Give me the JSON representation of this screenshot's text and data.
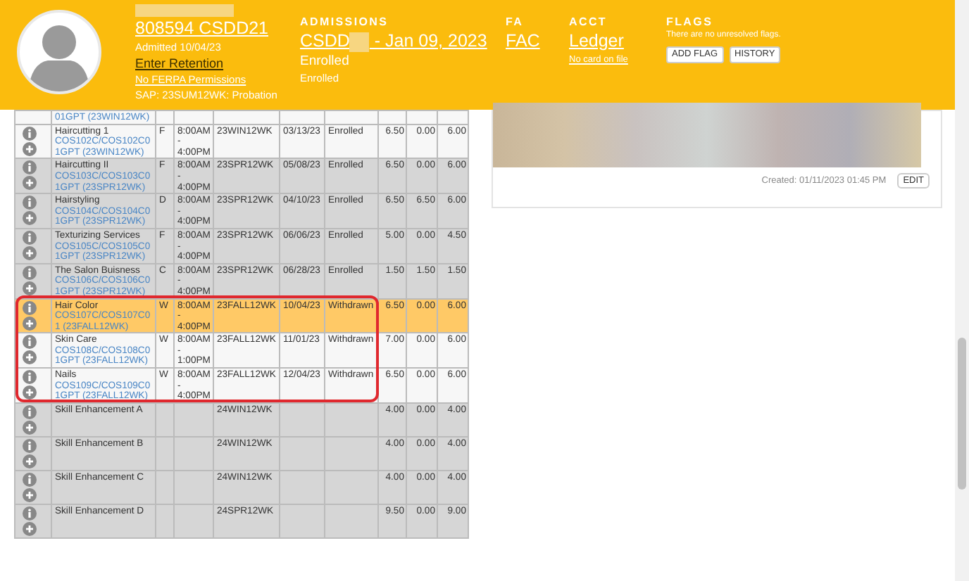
{
  "header": {
    "student": {
      "id_link": "808594 CSDD21",
      "admitted": "Admitted 10/04/23",
      "retention_link": "Enter Retention",
      "ferpa_link": "No FERPA Permissions",
      "sap": "SAP: 23SUM12WK: Probation"
    },
    "admissions": {
      "label": "ADMISSIONS",
      "link_start": "CSDD",
      "link_end": "- Jan 09, 2023",
      "status": "Enrolled",
      "substatus": "Enrolled"
    },
    "fa": {
      "label": "FA",
      "link": "FAC"
    },
    "acct": {
      "label": "ACCT",
      "link": "Ledger",
      "card_link": "No card on file"
    },
    "flags": {
      "label": "FLAGS",
      "message": "There are no unresolved flags.",
      "buttons": [
        "ADD FLAG",
        "HISTORY"
      ]
    }
  },
  "courses": [
    {
      "kind": "partial",
      "shaded": false,
      "selected": false,
      "circled": false,
      "code": "01GPT (23WIN12WK)"
    },
    {
      "kind": "course",
      "shaded": false,
      "selected": false,
      "circled": false,
      "name": "Haircutting 1",
      "code": "COS102C/COS102C01GPT (23WIN12WK)",
      "grade": "F",
      "time": "8:00AM - 4:00PM",
      "term": "23WIN12WK",
      "date": "03/13/23",
      "status": "Enrolled",
      "value_1": "6.50",
      "value_2": "0.00",
      "value_3": "6.00"
    },
    {
      "kind": "course",
      "shaded": true,
      "selected": false,
      "circled": false,
      "name": "Haircutting II",
      "code": "COS103C/COS103C01GPT (23SPR12WK)",
      "grade": "F",
      "time": "8:00AM - 4:00PM",
      "term": "23SPR12WK",
      "date": "05/08/23",
      "status": "Enrolled",
      "value_1": "6.50",
      "value_2": "0.00",
      "value_3": "6.00"
    },
    {
      "kind": "course",
      "shaded": true,
      "selected": false,
      "circled": false,
      "name": "Hairstyling",
      "code": "COS104C/COS104C01GPT (23SPR12WK)",
      "grade": "D",
      "time": "8:00AM - 4:00PM",
      "term": "23SPR12WK",
      "date": "04/10/23",
      "status": "Enrolled",
      "value_1": "6.50",
      "value_2": "6.50",
      "value_3": "6.00"
    },
    {
      "kind": "course",
      "shaded": true,
      "selected": false,
      "circled": false,
      "name": "Texturizing Services",
      "code": "COS105C/COS105C01GPT (23SPR12WK)",
      "grade": "F",
      "time": "8:00AM - 4:00PM",
      "term": "23SPR12WK",
      "date": "06/06/23",
      "status": "Enrolled",
      "value_1": "5.00",
      "value_2": "0.00",
      "value_3": "4.50"
    },
    {
      "kind": "course",
      "shaded": true,
      "selected": false,
      "circled": false,
      "name": "The Salon Buisness",
      "code": "COS106C/COS106C01GPT (23SPR12WK)",
      "grade": "C",
      "time": "8:00AM - 4:00PM",
      "term": "23SPR12WK",
      "date": "06/28/23",
      "status": "Enrolled",
      "value_1": "1.50",
      "value_2": "1.50",
      "value_3": "1.50"
    },
    {
      "kind": "course",
      "selected": true,
      "circled": true,
      "name": "Hair Color",
      "code": "COS107C/COS107C01 (23FALL12WK)",
      "grade": "W",
      "time": "8:00AM - 4:00PM",
      "term": "23FALL12WK",
      "date": "10/04/23",
      "status": "Withdrawn",
      "value_1": "6.50",
      "value_2": "0.00",
      "value_3": "6.00"
    },
    {
      "kind": "course",
      "shaded": false,
      "selected": false,
      "circled": true,
      "name": "Skin Care",
      "code": "COS108C/COS108C01GPT (23FALL12WK)",
      "grade": "W",
      "time": "8:00AM - 1:00PM",
      "term": "23FALL12WK",
      "date": "11/01/23",
      "status": "Withdrawn",
      "value_1": "7.00",
      "value_2": "0.00",
      "value_3": "6.00"
    },
    {
      "kind": "course",
      "shaded": false,
      "selected": false,
      "circled": true,
      "name": "Nails",
      "code": "COS109C/COS109C01GPT (23FALL12WK)",
      "grade": "W",
      "time": "8:00AM - 4:00PM",
      "term": "23FALL12WK",
      "date": "12/04/23",
      "status": "Withdrawn",
      "value_1": "6.50",
      "value_2": "0.00",
      "value_3": "6.00"
    },
    {
      "kind": "course",
      "shaded": true,
      "selected": false,
      "circled": false,
      "name": "Skill Enhancement A",
      "term": "24WIN12WK",
      "value_1": "4.00",
      "value_2": "0.00",
      "value_3": "4.00"
    },
    {
      "kind": "course",
      "shaded": true,
      "selected": false,
      "circled": false,
      "name": "Skill Enhancement B",
      "term": "24WIN12WK",
      "value_1": "4.00",
      "value_2": "0.00",
      "value_3": "4.00"
    },
    {
      "kind": "course",
      "shaded": true,
      "selected": false,
      "circled": false,
      "name": "Skill Enhancement C",
      "term": "24WIN12WK",
      "value_1": "4.00",
      "value_2": "0.00",
      "value_3": "4.00"
    },
    {
      "kind": "course",
      "shaded": true,
      "selected": false,
      "circled": false,
      "name": "Skill Enhancement D",
      "term": "24SPR12WK",
      "value_1": "9.50",
      "value_2": "0.00",
      "value_3": "9.00"
    }
  ],
  "note_card": {
    "created": "Created: 01/11/2023 01:45 PM",
    "button": "EDIT"
  }
}
